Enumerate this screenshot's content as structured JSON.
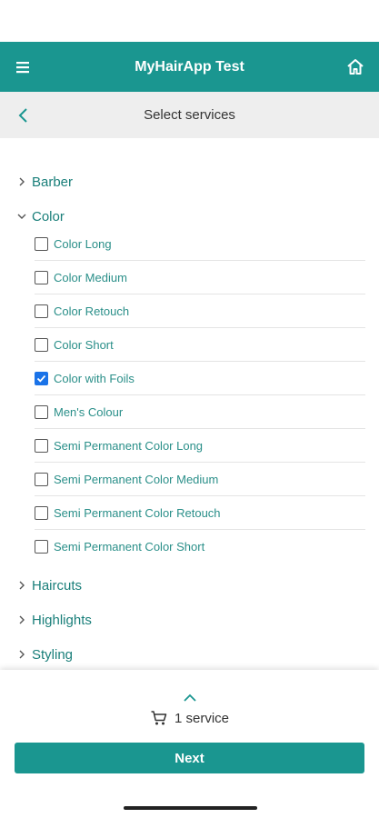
{
  "app_bar": {
    "title": "MyHairApp Test",
    "menu_icon": "hamburger-menu-icon",
    "home_icon": "home-icon",
    "background_color": "#1a9690"
  },
  "sub_header": {
    "title": "Select services",
    "back_icon": "chevron-left-icon"
  },
  "categories": [
    {
      "label": "Barber",
      "expanded": false
    },
    {
      "label": "Color",
      "expanded": true
    },
    {
      "label": "Haircuts",
      "expanded": false
    },
    {
      "label": "Highlights",
      "expanded": false
    },
    {
      "label": "Styling",
      "expanded": false
    }
  ],
  "color_services": [
    {
      "label": "Color Long",
      "checked": false
    },
    {
      "label": "Color Medium",
      "checked": false
    },
    {
      "label": "Color Retouch",
      "checked": false
    },
    {
      "label": "Color Short",
      "checked": false
    },
    {
      "label": "Color with Foils",
      "checked": true
    },
    {
      "label": "Men's Colour",
      "checked": false
    },
    {
      "label": "Semi Permanent Color Long",
      "checked": false
    },
    {
      "label": "Semi Permanent Color Medium",
      "checked": false
    },
    {
      "label": "Semi Permanent Color Retouch",
      "checked": false
    },
    {
      "label": "Semi Permanent Color Short",
      "checked": false
    }
  ],
  "footer": {
    "expand_icon": "chevron-up-icon",
    "cart_icon": "cart-icon",
    "cart_text": "1 service",
    "next_label": "Next",
    "accent_color": "#1a9690",
    "checkbox_color": "#1a73e8"
  }
}
